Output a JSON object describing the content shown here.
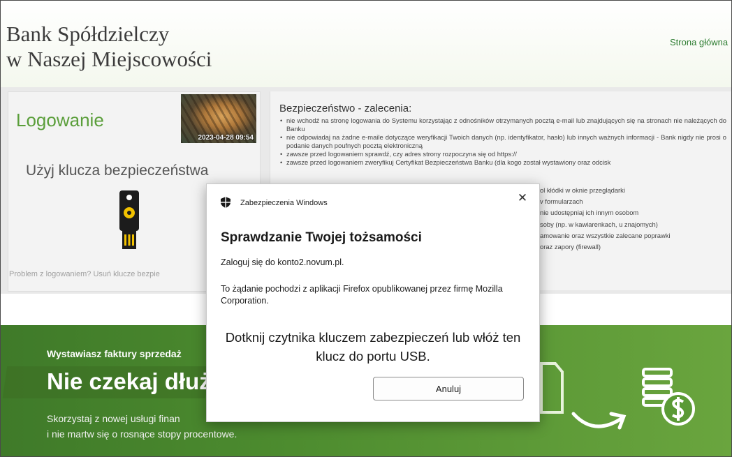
{
  "header": {
    "bank_name_line1": "Bank Spółdzielczy",
    "bank_name_line2": "w Naszej Miejscowości",
    "home_link": "Strona główna"
  },
  "login": {
    "title": "Logowanie",
    "photo_timestamp": "2023-04-28 09:54",
    "use_key_text": "Użyj klucza bezpieczeństwa",
    "problem_text": "Problem z logowaniem? Usuń klucze bezpie"
  },
  "security": {
    "title": "Bezpieczeństwo - zalecenia:",
    "items": [
      "nie wchodź na stronę logowania do Systemu korzystając z odnośników otrzymanych pocztą e-mail lub znajdujących się na stronach nie należących do Banku",
      "nie odpowiadaj na żadne e-maile dotyczące weryfikacji Twoich danych (np. identyfikator, hasło) lub innych ważnych informacji - Bank nigdy nie prosi o podanie danych poufnych pocztą elektroniczną",
      "zawsze przed logowaniem sprawdź, czy adres strony rozpoczyna się od https://",
      "zawsze przed logowaniem zweryfikuj Certyfikat Bezpieczeństwa Banku (dla kogo został wystawiony oraz odcisk"
    ],
    "fragments": [
      "ol kłódki w oknie przeglądarki",
      "v formularzach",
      "nie udostępniaj ich innym osobom",
      "soby (np. w kawiarenkach, u znajomych)",
      "amowanie oraz wszystkie zalecane poprawki",
      "oraz zapory (firewall)"
    ]
  },
  "promo": {
    "lead": "Wystawiasz faktury sprzedaż",
    "headline": "Nie czekaj dłuże",
    "sub_line1": "Skorzystaj z nowej usługi finan",
    "sub_line2": "i nie martw się o rosnące stopy procentowe."
  },
  "dialog": {
    "app_name": "Zabezpieczenia Windows",
    "close_symbol": "✕",
    "title": "Sprawdzanie Twojej tożsamości",
    "signin_text": "Zaloguj się do konto2.novum.pl.",
    "origin_text": "To żądanie pochodzi z aplikacji Firefox opublikowanej przez firmę Mozilla Corporation.",
    "instruction_text": "Dotknij czytnika kluczem zabezpieczeń lub włóż ten klucz do portu USB.",
    "cancel_label": "Anuluj"
  },
  "icons": {
    "shield": "shield-icon",
    "close": "close-icon",
    "usb_key": "usb-security-key-icon",
    "coins": "coins-icon",
    "arrow": "curved-arrow-icon",
    "document": "invoice-document-icon"
  },
  "colors": {
    "accent_green": "#5a9e3a",
    "link_green": "#2e7d32",
    "promo_green": "#4d8c2f",
    "key_yellow": "#f2c200"
  }
}
